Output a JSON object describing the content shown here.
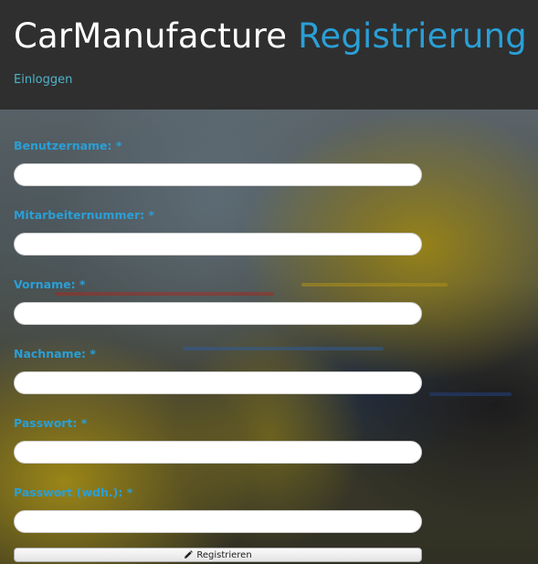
{
  "header": {
    "title_main": "CarManufacture",
    "title_accent": "Registrierung",
    "login_link": "Einloggen"
  },
  "form": {
    "fields": [
      {
        "label": "Benutzername: *",
        "value": ""
      },
      {
        "label": "Mitarbeiternummer: *",
        "value": ""
      },
      {
        "label": "Vorname: *",
        "value": ""
      },
      {
        "label": "Nachname: *",
        "value": ""
      },
      {
        "label": "Passwort: *",
        "value": ""
      },
      {
        "label": "Passwort (wdh.): *",
        "value": ""
      }
    ],
    "submit_label": "Registrieren",
    "submit_icon": "pencil-icon"
  },
  "colors": {
    "accent": "#2a9fd6",
    "header_bg": "#2f2f2f",
    "link": "#4fb3c9"
  }
}
